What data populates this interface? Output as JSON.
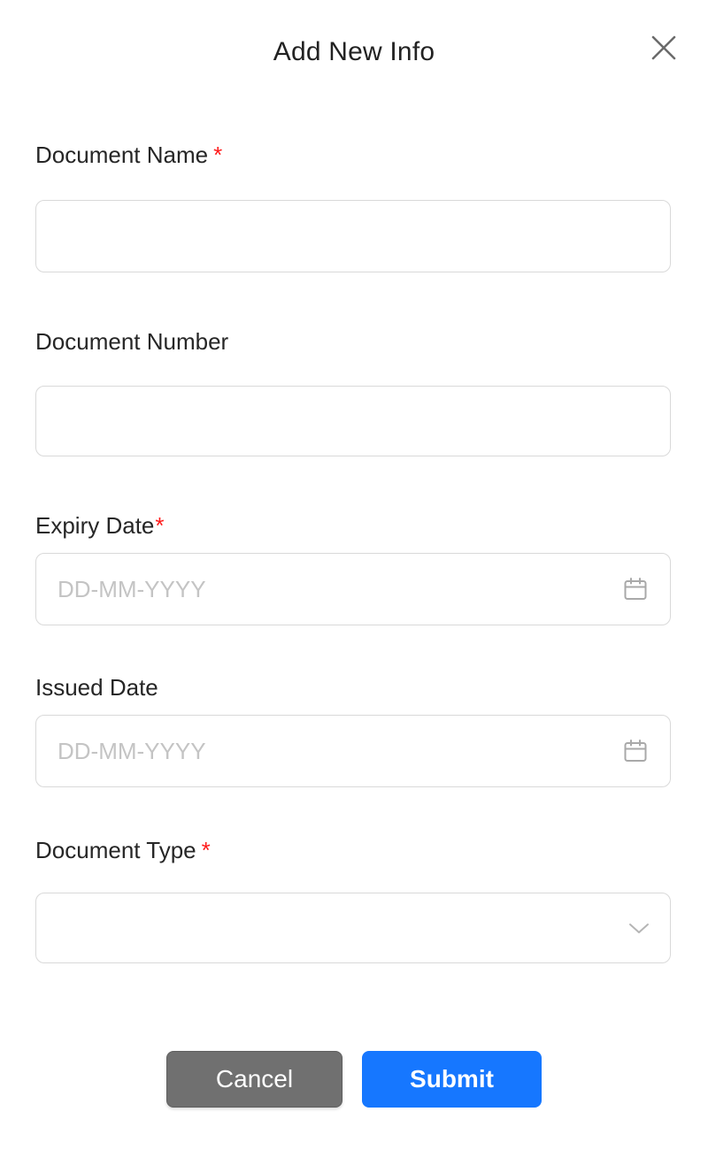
{
  "dialog": {
    "title": "Add New Info",
    "close_icon": "close-icon"
  },
  "fields": {
    "document_name": {
      "label": "Document Name",
      "required_mark": "*",
      "value": "",
      "placeholder": ""
    },
    "document_number": {
      "label": "Document Number",
      "value": "",
      "placeholder": ""
    },
    "expiry_date": {
      "label": "Expiry Date",
      "required_mark": "*",
      "value": "",
      "placeholder": "DD-MM-YYYY",
      "icon": "calendar-icon"
    },
    "issued_date": {
      "label": "Issued Date",
      "value": "",
      "placeholder": "DD-MM-YYYY",
      "icon": "calendar-icon"
    },
    "document_type": {
      "label": "Document Type",
      "required_mark": "*",
      "selected": "",
      "icon": "chevron-down-icon"
    }
  },
  "actions": {
    "cancel_label": "Cancel",
    "submit_label": "Submit"
  },
  "colors": {
    "required": "#ff1a1a",
    "primary": "#1677ff",
    "secondary": "#707070",
    "border": "#d9d9d9",
    "placeholder": "#c4c4c4"
  }
}
